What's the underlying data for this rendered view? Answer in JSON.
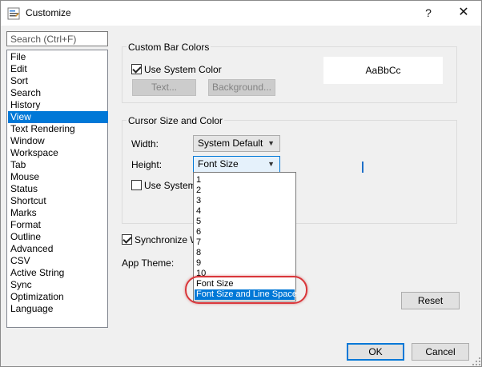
{
  "window": {
    "title": "Customize",
    "help": "?",
    "close": "✕"
  },
  "search": {
    "placeholder": "Search (Ctrl+F)"
  },
  "nav": {
    "items": [
      "File",
      "Edit",
      "Sort",
      "Search",
      "History",
      "View",
      "Text Rendering",
      "Window",
      "Workspace",
      "Tab",
      "Mouse",
      "Status",
      "Shortcut",
      "Marks",
      "Format",
      "Outline",
      "Advanced",
      "CSV",
      "Active String",
      "Sync",
      "Optimization",
      "Language"
    ],
    "selected": "View"
  },
  "bar_colors": {
    "legend": "Custom Bar Colors",
    "use_system_color": "Use System Color",
    "text_button": "Text...",
    "background_button": "Background...",
    "preview": "AaBbCc"
  },
  "cursor": {
    "legend": "Cursor Size and Color",
    "width_label": "Width:",
    "width_value": "System Default",
    "height_label": "Height:",
    "height_value": "Font Size",
    "use_system_color": "Use System C"
  },
  "sync_wrap": "Synchronize Wr",
  "app_theme_label": "App Theme:",
  "dropdown": {
    "options": [
      "1",
      "2",
      "3",
      "4",
      "5",
      "6",
      "7",
      "8",
      "9",
      "10",
      "Font Size",
      "Font Size and Line Space"
    ],
    "highlighted": "Font Size and Line Space"
  },
  "buttons": {
    "reset": "Reset",
    "ok": "OK",
    "cancel": "Cancel"
  },
  "colors": {
    "accent": "#0078d7",
    "annotation": "#d9363a"
  }
}
